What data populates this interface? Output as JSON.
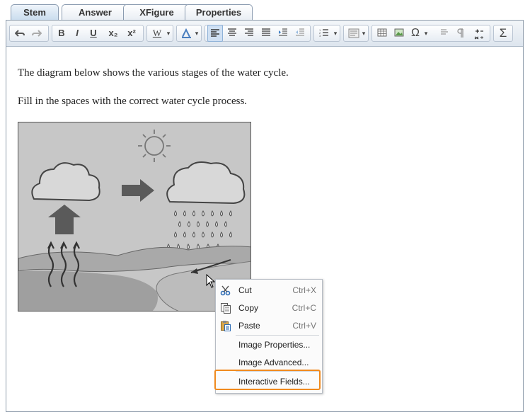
{
  "tabs": [
    {
      "label": "Stem",
      "active": true
    },
    {
      "label": "Answer",
      "active": false
    },
    {
      "label": "XFigure",
      "active": false
    },
    {
      "label": "Properties",
      "active": false
    }
  ],
  "toolbar": {
    "bold_label": "B",
    "italic_label": "I",
    "underline_label": "U",
    "subscript_label": "x₂",
    "superscript_label": "x²",
    "word_label": "W",
    "special_char_label": "Ω",
    "equation_label": "Σ",
    "icons": [
      "undo-icon",
      "redo-icon",
      "font-color-icon",
      "align-left-icon",
      "align-center-icon",
      "align-right-icon",
      "justify-icon",
      "indent-icon",
      "outdent-icon",
      "list-icon",
      "format-icon",
      "table-icon",
      "image-icon",
      "special-char-icon",
      "paragraph-icon",
      "pilcrow-icon",
      "math-icon",
      "sum-icon"
    ]
  },
  "content": {
    "line1": "The diagram below shows the various stages of the water cycle.",
    "line2": "Fill in the spaces with the correct water cycle process."
  },
  "context_menu": {
    "items": [
      {
        "label": "Cut",
        "shortcut": "Ctrl+X",
        "icon": "scissors-icon"
      },
      {
        "label": "Copy",
        "shortcut": "Ctrl+C",
        "icon": "copy-icon"
      },
      {
        "label": "Paste",
        "shortcut": "Ctrl+V",
        "icon": "paste-icon"
      },
      {
        "label": "Image Properties..."
      },
      {
        "label": "Image Advanced..."
      },
      {
        "label": "Interactive Fields..."
      }
    ],
    "highlight_color": "#f08a1e"
  }
}
